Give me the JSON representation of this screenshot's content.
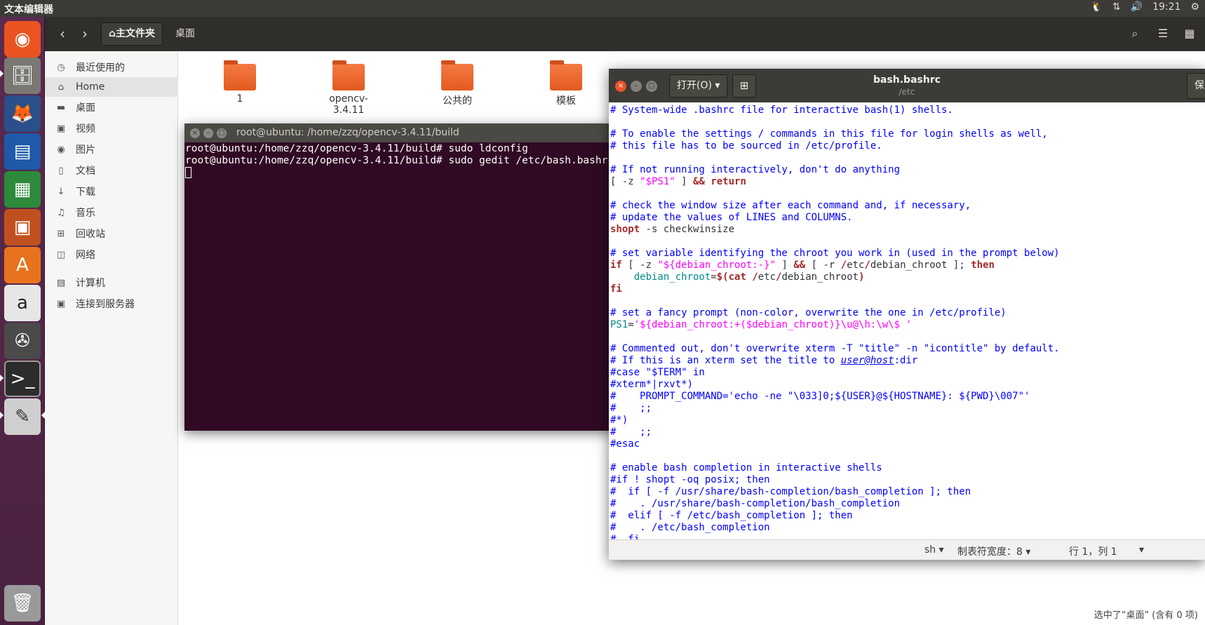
{
  "top_panel": {
    "app_title": "文本编辑器",
    "clock": "19:21"
  },
  "launcher": {
    "items": [
      "ubuntu-logo-icon",
      "files-icon",
      "firefox-icon",
      "writer-icon",
      "calc-icon",
      "impress-icon",
      "software-center-icon",
      "amazon-icon",
      "settings-icon",
      "terminal-icon",
      "text-editor-icon",
      "trash-icon"
    ]
  },
  "files": {
    "path_home": "⌂主文件夹",
    "path_desktop": "桌面",
    "sidebar": [
      {
        "icon": "◷",
        "label": "最近使用的"
      },
      {
        "icon": "⌂",
        "label": "Home"
      },
      {
        "icon": "▬",
        "label": "桌面"
      },
      {
        "icon": "▣",
        "label": "视频"
      },
      {
        "icon": "◉",
        "label": "图片"
      },
      {
        "icon": "▯",
        "label": "文档"
      },
      {
        "icon": "↓",
        "label": "下载"
      },
      {
        "icon": "♫",
        "label": "音乐"
      },
      {
        "icon": "⊞",
        "label": "回收站"
      },
      {
        "icon": "◫",
        "label": "网络"
      },
      {
        "icon": "▤",
        "label": "计算机"
      },
      {
        "icon": "▣",
        "label": "连接到服务器"
      }
    ],
    "folders": [
      "1",
      "opencv-3.4.11",
      "公共的",
      "模板"
    ],
    "status": "选中了“桌面” (含有 0 项)"
  },
  "terminal": {
    "title": "root@ubuntu: /home/zzq/opencv-3.4.11/build",
    "lines": [
      "root@ubuntu:/home/zzq/opencv-3.4.11/build# sudo ldconfig",
      "root@ubuntu:/home/zzq/opencv-3.4.11/build# sudo gedit /etc/bash.bashrc"
    ]
  },
  "gedit": {
    "open_label": "打开(O) ▾",
    "title": "bash.bashrc",
    "subtitle": "/etc",
    "save_label": "保",
    "status": {
      "language": "sh ▾",
      "tab_width": "制表符宽度：8 ▾",
      "position": "行 1，列 1",
      "menu": "▾"
    },
    "code_lines": [
      [
        [
          "cm",
          "# System-wide .bashrc file for interactive bash(1) shells."
        ]
      ],
      [
        [
          "t",
          ""
        ]
      ],
      [
        [
          "cm",
          "# To enable the settings / commands in this file for login shells as well,"
        ]
      ],
      [
        [
          "cm",
          "# this file has to be sourced in /etc/profile."
        ]
      ],
      [
        [
          "t",
          ""
        ]
      ],
      [
        [
          "cm",
          "# If not running interactively, don't do anything"
        ]
      ],
      [
        [
          "t",
          "[ -z "
        ],
        [
          "str",
          "\"$PS1\""
        ],
        [
          "t",
          " ] "
        ],
        [
          "kw",
          "&&"
        ],
        [
          "t",
          " "
        ],
        [
          "kw",
          "return"
        ]
      ],
      [
        [
          "t",
          ""
        ]
      ],
      [
        [
          "cm",
          "# check the window size after each command and, if necessary,"
        ]
      ],
      [
        [
          "cm",
          "# update the values of LINES and COLUMNS."
        ]
      ],
      [
        [
          "kw",
          "shopt"
        ],
        [
          "t",
          " -s checkwinsize"
        ]
      ],
      [
        [
          "t",
          ""
        ]
      ],
      [
        [
          "cm",
          "# set variable identifying the chroot you work in (used in the prompt below)"
        ]
      ],
      [
        [
          "kw",
          "if"
        ],
        [
          "t",
          " [ -z "
        ],
        [
          "str",
          "\"${debian_chroot:-}\""
        ],
        [
          "t",
          " ] "
        ],
        [
          "kw",
          "&&"
        ],
        [
          "t",
          " [ -r "
        ],
        [
          "kw",
          "/"
        ],
        [
          "t",
          "etc"
        ],
        [
          "kw",
          "/"
        ],
        [
          "t",
          "debian_chroot ]; "
        ],
        [
          "kw",
          "then"
        ]
      ],
      [
        [
          "t",
          "    "
        ],
        [
          "var",
          "debian_chroot"
        ],
        [
          "t",
          "="
        ],
        [
          "kw",
          "$("
        ],
        [
          "kw",
          "cat"
        ],
        [
          "t",
          " "
        ],
        [
          "kw",
          "/"
        ],
        [
          "t",
          "etc"
        ],
        [
          "kw",
          "/"
        ],
        [
          "t",
          "debian_chroot"
        ],
        [
          "kw",
          ")"
        ]
      ],
      [
        [
          "kw",
          "fi"
        ]
      ],
      [
        [
          "t",
          ""
        ]
      ],
      [
        [
          "cm",
          "# set a fancy prompt (non-color, overwrite the one in /etc/profile)"
        ]
      ],
      [
        [
          "var",
          "PS1"
        ],
        [
          "t",
          "="
        ],
        [
          "str",
          "'${debian_chroot:+($debian_chroot)}\\u@\\h:\\w\\$ '"
        ]
      ],
      [
        [
          "t",
          ""
        ]
      ],
      [
        [
          "cm",
          "# Commented out, don't overwrite xterm -T \"title\" -n \"icontitle\" by default."
        ]
      ],
      [
        [
          "cm",
          "# If this is an xterm set the title to "
        ],
        [
          "u",
          "user@host"
        ],
        [
          "cm",
          ":dir"
        ]
      ],
      [
        [
          "cm",
          "#case \"$TERM\" in"
        ]
      ],
      [
        [
          "cm",
          "#xterm*|rxvt*)"
        ]
      ],
      [
        [
          "cm",
          "#    PROMPT_COMMAND='echo -ne \"\\033]0;${USER}@${HOSTNAME}: ${PWD}\\007\"'"
        ]
      ],
      [
        [
          "cm",
          "#    ;;"
        ]
      ],
      [
        [
          "cm",
          "#*)"
        ]
      ],
      [
        [
          "cm",
          "#    ;;"
        ]
      ],
      [
        [
          "cm",
          "#esac"
        ]
      ],
      [
        [
          "t",
          ""
        ]
      ],
      [
        [
          "cm",
          "# enable bash completion in interactive shells"
        ]
      ],
      [
        [
          "cm",
          "#if ! shopt -oq posix; then"
        ]
      ],
      [
        [
          "cm",
          "#  if [ -f /usr/share/bash-completion/bash_completion ]; then"
        ]
      ],
      [
        [
          "cm",
          "#    . /usr/share/bash-completion/bash_completion"
        ]
      ],
      [
        [
          "cm",
          "#  elif [ -f /etc/bash_completion ]; then"
        ]
      ],
      [
        [
          "cm",
          "#    . /etc/bash_completion"
        ]
      ],
      [
        [
          "cm",
          "#  fi"
        ]
      ]
    ]
  }
}
